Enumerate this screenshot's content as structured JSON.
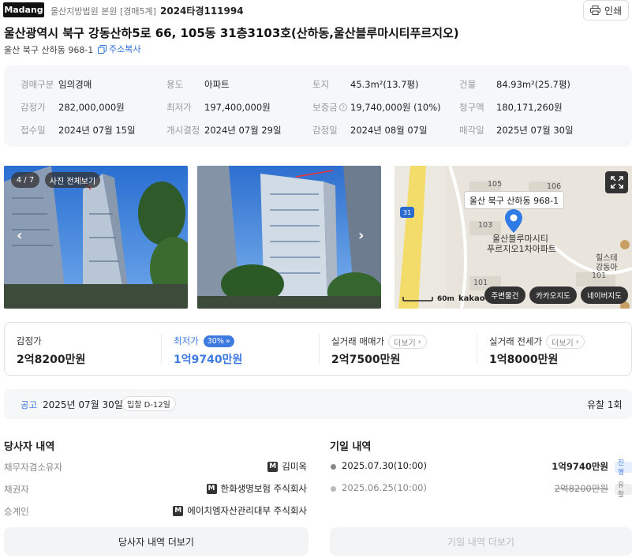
{
  "header": {
    "logo": "Madang",
    "court": "울산지방법원 본원 [경매5계]",
    "case_number": "2024타경111994",
    "print_label": "인쇄"
  },
  "address": {
    "title": "울산광역시 북구 강동산하5로 66, 105동 31층3103호(산하동,울산블루마시티푸르지오)",
    "sub": "울산 북구 산하동 968-1",
    "copy_label": "주소복사"
  },
  "info": {
    "auction_type_label": "경매구분",
    "auction_type": "임의경매",
    "usage_label": "용도",
    "usage": "아파트",
    "land_label": "토지",
    "land": "45.3m²(13.7평)",
    "building_label": "건물",
    "building": "84.93m²(25.7평)",
    "appraisal_label": "감정가",
    "appraisal": "282,000,000원",
    "min_price_label": "최저가",
    "min_price": "197,400,000원",
    "deposit_label": "보증금",
    "deposit": "19,740,000원 (10%)",
    "claim_label": "청구액",
    "claim": "180,171,260원",
    "received_label": "접수일",
    "received": "2024년 07월 15일",
    "decision_label": "개시결정",
    "decision": "2024년 07월 29일",
    "appraisal_date_label": "감정일",
    "appraisal_date": "2024년 08월 07일",
    "sale_date_label": "매각일",
    "sale_date": "2025년 07월 30일"
  },
  "photos": {
    "counter": "4 / 7",
    "view_all": "사진 전체보기"
  },
  "map": {
    "location_label": "울산 북구 산하동 968-1",
    "place_label_1": "울산블루마시티",
    "place_label_2": "푸르지오1차아파트",
    "block_105": "105",
    "block_106": "106",
    "block_103": "103",
    "block_101a": "101",
    "block_101b": "101",
    "road": "31",
    "nearby_1": "힐스테",
    "nearby_2": "강동아",
    "scale": "60m",
    "provider": "kakao",
    "btn_nearby": "주변물건",
    "btn_kakao": "카카오지도",
    "btn_naver": "네이버지도"
  },
  "prices": {
    "appraisal_label": "감정가",
    "appraisal_value": "2억8200만원",
    "min_label": "최저가",
    "min_pct": "30%",
    "min_value": "1억9740만원",
    "sale_label": "실거래 매매가",
    "sale_value": "2억7500만원",
    "rent_label": "실거래 전세가",
    "rent_value": "1억8000만원",
    "more_label": "더보기"
  },
  "notice": {
    "label": "공고",
    "date": "2025년 07월 30일",
    "dday": "입찰 D-12일",
    "result": "유찰 1회"
  },
  "parties": {
    "title": "당사자 내역",
    "rows": [
      {
        "label": "채무자겸소유자",
        "value": "김미옥"
      },
      {
        "label": "채권자",
        "value": "한화생명보험 주식회사"
      },
      {
        "label": "승계인",
        "value": "에이치엠자산관리대부 주식회사"
      }
    ],
    "more_button": "당사자 내역 더보기"
  },
  "bids": {
    "title": "기일 내역",
    "rows": [
      {
        "date": "2025.07.30(10:00)",
        "price": "1억9740만원",
        "status": "진행"
      },
      {
        "date": "2025.06.25(10:00)",
        "price": "2억8200만원",
        "status": "유찰"
      }
    ],
    "more_button": "기일 내역 더보기"
  },
  "colors": {
    "accent": "#3f7ae0",
    "logo_bg": "#111111",
    "panel_bg": "#f6f7f9"
  }
}
